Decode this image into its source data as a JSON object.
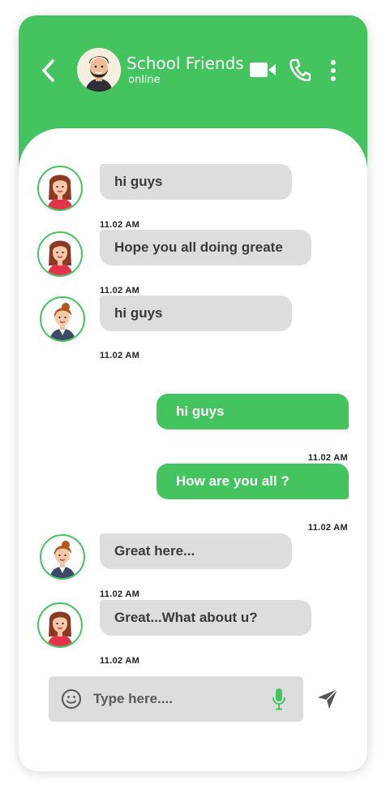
{
  "header": {
    "title": "School Friends",
    "status": "online"
  },
  "messages": [
    {
      "direction": "in",
      "avatar": "woman-red-dress-avatar",
      "text": "hi guys",
      "time": "11.02 AM"
    },
    {
      "direction": "in",
      "avatar": "woman-red-dress-avatar",
      "text": "Hope you all doing greate",
      "time": "11.02 AM"
    },
    {
      "direction": "in",
      "avatar": "woman-blazer-avatar",
      "text": "hi guys",
      "time": "11.02 AM"
    },
    {
      "direction": "out",
      "text": "hi guys",
      "time": "11.02 AM"
    },
    {
      "direction": "out",
      "text": "How are you all ?",
      "time": "11.02 AM"
    },
    {
      "direction": "in",
      "avatar": "woman-blazer-avatar",
      "text": "Great here...",
      "time": "11.02 AM"
    },
    {
      "direction": "in",
      "avatar": "woman-red-dress-avatar",
      "text": "Great...What about u?",
      "time": "11.02 AM"
    }
  ],
  "composer": {
    "placeholder": "Type here....",
    "value": ""
  },
  "icons": {
    "back": "chevron-left-icon",
    "video": "video-camera-icon",
    "call": "phone-icon",
    "more": "more-vertical-icon",
    "emoji": "smiley-icon",
    "mic": "microphone-icon",
    "send": "send-paper-plane-icon"
  },
  "colors": {
    "accent": "#43c45e",
    "incoming_bubble": "#dddddd",
    "background": "#ffffff"
  }
}
